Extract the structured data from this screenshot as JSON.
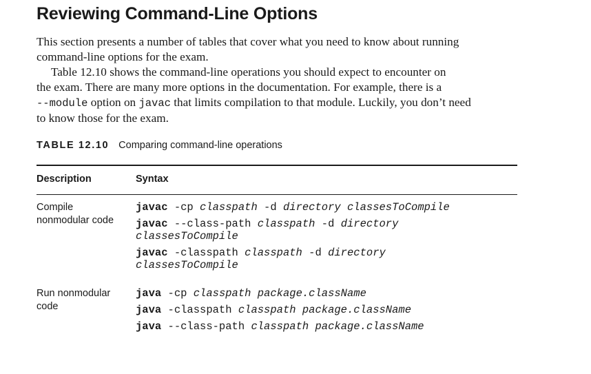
{
  "section": {
    "title": "Reviewing Command-Line Options"
  },
  "paragraphs": {
    "p1": {
      "line1": "This section presents a number of tables that cover what you need to know about running",
      "line2": "command-line options for the exam."
    },
    "p2": {
      "line1": "Table 12.10 shows the command-line operations you should expect to encounter on",
      "line2": "the exam. There are many more options in the documentation. For example, there is a",
      "line3_code1": "--module",
      "line3_text1": " option on ",
      "line3_code2": "javac",
      "line3_text2": " that limits compilation to that module. Luckily, you don’t need",
      "line4": "to know those for the exam."
    }
  },
  "table": {
    "number": "TABLE 12.10",
    "caption": "Comparing command-line operations",
    "headers": {
      "description": "Description",
      "syntax": "Syntax"
    },
    "rows": [
      {
        "description_lines": [
          "Compile",
          "nonmodular code"
        ],
        "syntax": [
          {
            "cmd": "javac",
            "s1": " -cp ",
            "a1": "classpath",
            "s2": " -d ",
            "a2": "directory",
            "s3": " ",
            "a3": "classesToCompile"
          },
          {
            "cmd": "javac",
            "s1": " --class-path ",
            "a1": "classpath",
            "s2": " -d ",
            "a2": "directory",
            "wrap": "classesToCompile"
          },
          {
            "cmd": "javac",
            "s1": " -classpath ",
            "a1": "classpath",
            "s2": " -d ",
            "a2": "directory",
            "wrap": "classesToCompile"
          }
        ]
      },
      {
        "description_lines": [
          "Run nonmodular",
          "code"
        ],
        "syntax": [
          {
            "cmd": "java",
            "s1": " -cp ",
            "a1": "classpath",
            "s2": " ",
            "a2": "package.className"
          },
          {
            "cmd": "java",
            "s1": " -classpath ",
            "a1": "classpath",
            "s2": " ",
            "a2": "package.className"
          },
          {
            "cmd": "java",
            "s1": " --class-path ",
            "a1": "classpath",
            "s2": " ",
            "a2": "package.className"
          }
        ]
      }
    ]
  }
}
